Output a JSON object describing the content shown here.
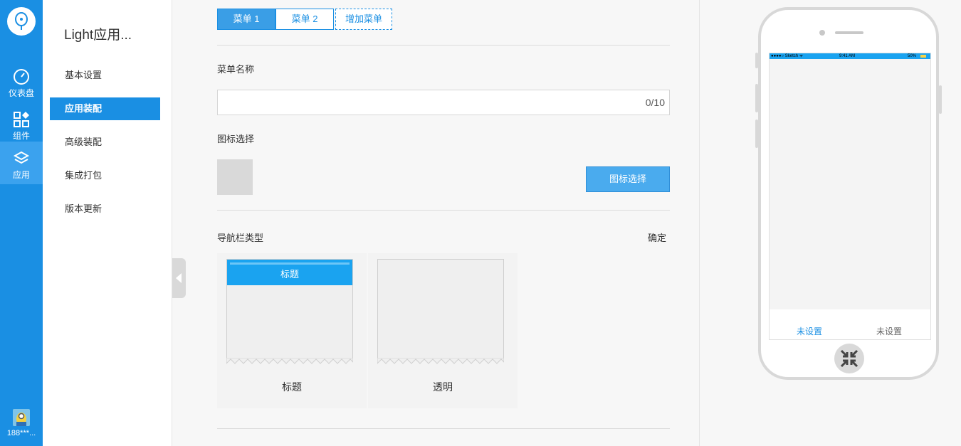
{
  "rail": {
    "items": [
      {
        "label": "仪表盘",
        "icon": "dashboard-icon"
      },
      {
        "label": "组件",
        "icon": "components-icon"
      },
      {
        "label": "应用",
        "icon": "app-icon"
      }
    ],
    "user_name": "188***...",
    "accent": "#1a8fe3"
  },
  "subnav": {
    "title": "Light应用...",
    "items": [
      {
        "label": "基本设置"
      },
      {
        "label": "应用装配"
      },
      {
        "label": "高级装配"
      },
      {
        "label": "集成打包"
      },
      {
        "label": "版本更新"
      }
    ]
  },
  "main": {
    "tabs": [
      {
        "label": "菜单 1"
      },
      {
        "label": "菜单 2"
      },
      {
        "label": "增加菜单"
      }
    ],
    "menu_name_label": "菜单名称",
    "menu_name_value": "",
    "menu_name_counter": "0/10",
    "icon_label": "图标选择",
    "icon_button": "图标选择",
    "nav_type_label": "导航栏类型",
    "confirm": "确定",
    "nav_options": [
      {
        "caption": "标题",
        "bar_text": "标题"
      },
      {
        "caption": "透明"
      }
    ]
  },
  "preview": {
    "status_left": "●●●●○ Sketch ᯤ",
    "status_time": "9:41 AM",
    "status_right": "50%",
    "tabbar": [
      "未设置",
      "未设置"
    ]
  }
}
